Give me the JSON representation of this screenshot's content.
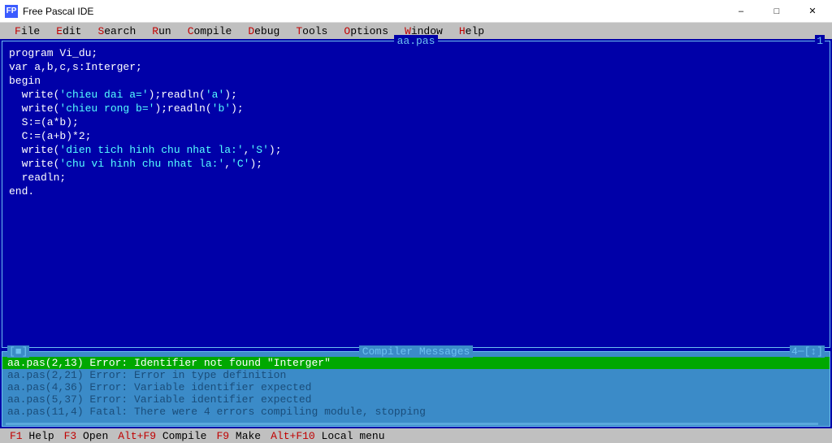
{
  "window": {
    "title": "Free Pascal IDE",
    "icon_label": "FP"
  },
  "menu": [
    {
      "hot": "F",
      "rest": "ile"
    },
    {
      "hot": "E",
      "rest": "dit"
    },
    {
      "hot": "S",
      "rest": "earch"
    },
    {
      "hot": "R",
      "rest": "un"
    },
    {
      "hot": "C",
      "rest": "ompile"
    },
    {
      "hot": "D",
      "rest": "ebug"
    },
    {
      "hot": "T",
      "rest": "ools"
    },
    {
      "hot": "O",
      "rest": "ptions"
    },
    {
      "hot": "W",
      "rest": "indow"
    },
    {
      "hot": "H",
      "rest": "elp"
    }
  ],
  "editor": {
    "filename": "aa.pas",
    "window_number": "1",
    "lines": [
      {
        "t": "program Vi_du;"
      },
      {
        "t": "var a,b,c,s:Interger;"
      },
      {
        "t": "begin"
      },
      {
        "t": "  write('chieu dai a=');readln('a');"
      },
      {
        "t": "  write('chieu rong b=');readln('b');"
      },
      {
        "t": "  S:=(a*b);"
      },
      {
        "t": "  C:=(a+b)*2;"
      },
      {
        "t": "  write('dien tich hinh chu nhat la:','S');"
      },
      {
        "t": "  write('chu vi hinh chu nhat la:','C');"
      },
      {
        "t": "  readln;"
      },
      {
        "t": "end."
      }
    ]
  },
  "compiler": {
    "title": "Compiler Messages",
    "close_glyph": "[■]",
    "window_number": "4─[↕]",
    "messages": [
      {
        "text": "aa.pas(2,13) Error: Identifier not found \"Interger\"",
        "selected": true
      },
      {
        "text": "aa.pas(2,21) Error: Error in type definition",
        "selected": false
      },
      {
        "text": "aa.pas(4,36) Error: Variable identifier expected",
        "selected": false
      },
      {
        "text": "aa.pas(5,37) Error: Variable identifier expected",
        "selected": false
      },
      {
        "text": "aa.pas(11,4) Fatal: There were 4 errors compiling module, stopping",
        "selected": false
      }
    ]
  },
  "status": [
    {
      "hot": "F1",
      "label": " Help"
    },
    {
      "hot": "F3",
      "label": " Open"
    },
    {
      "hot": "Alt+F9",
      "label": " Compile"
    },
    {
      "hot": "F9",
      "label": " Make"
    },
    {
      "hot": "Alt+F10",
      "label": " Local menu"
    }
  ]
}
